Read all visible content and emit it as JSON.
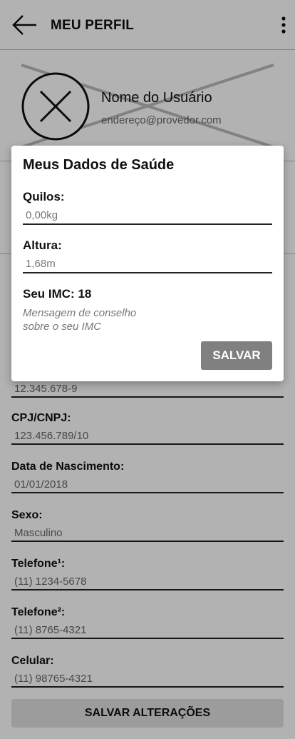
{
  "appbar": {
    "title": "MEU PERFIL",
    "back_icon": "arrow-left-icon",
    "menu_icon": "more-vertical-icon"
  },
  "profile": {
    "name": "Nome do Usuário",
    "email": "endereço@provedor.com",
    "avatar_icon": "close-circle-icon"
  },
  "form": {
    "partial_value": "12.345.678-9",
    "fields": [
      {
        "label": "CPJ/CNPJ:",
        "value": "123.456.789/10"
      },
      {
        "label": "Data de Nascimento:",
        "value": "01/01/2018"
      },
      {
        "label": "Sexo:",
        "value": "Masculino"
      },
      {
        "label": "Telefone¹:",
        "value": "(11) 1234-5678"
      },
      {
        "label": "Telefone²:",
        "value": "(11) 8765-4321"
      },
      {
        "label": "Celular:",
        "value": "(11) 98765-4321"
      }
    ],
    "save_label": "SALVAR ALTERAÇÕES"
  },
  "modal": {
    "title": "Meus Dados de Saúde",
    "weight_label": "Quilos:",
    "weight_placeholder": "0,00kg",
    "height_label": "Altura:",
    "height_value": "1,68m",
    "imc_text": "Seu IMC: 18",
    "advice_line1": "Mensagem de conselho",
    "advice_line2": "sobre o seu IMC",
    "save_label": "SALVAR"
  }
}
